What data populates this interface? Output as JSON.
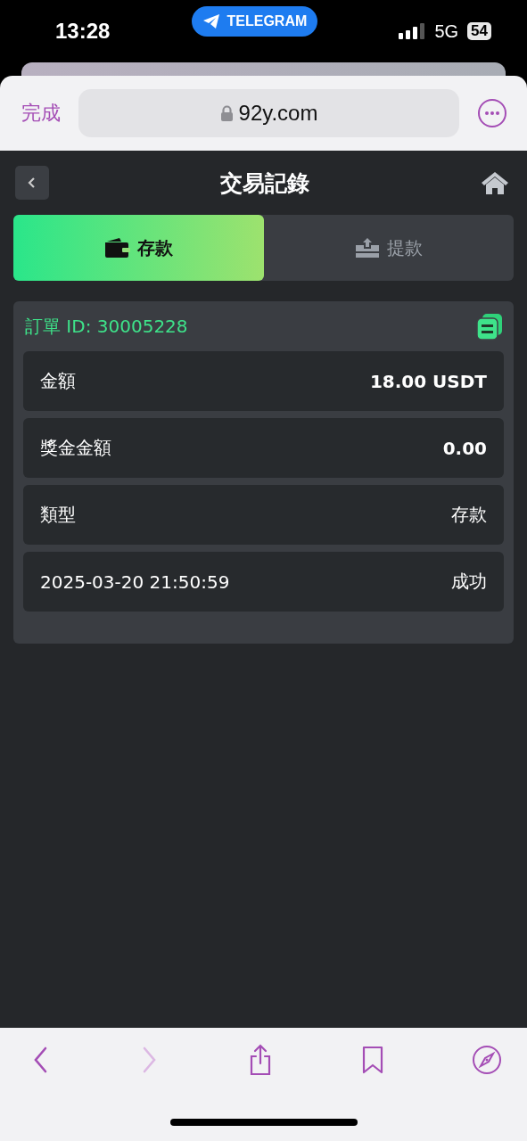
{
  "status_bar": {
    "time": "13:28",
    "back_app": "TELEGRAM",
    "network": "5G",
    "battery": "54"
  },
  "browser": {
    "done": "完成",
    "url": "92y.com"
  },
  "header": {
    "title": "交易記錄"
  },
  "tabs": [
    {
      "label": "存款",
      "kind": "deposit",
      "selected": true
    },
    {
      "label": "提款",
      "kind": "withdraw",
      "selected": false
    }
  ],
  "order": {
    "id_label": "訂單 ID: 30005228",
    "rows": [
      {
        "label": "金額",
        "value": "18.00 USDT",
        "kind": "bold"
      },
      {
        "label": "獎金金額",
        "value": "0.00",
        "kind": "bold"
      },
      {
        "label": "類型",
        "value": "存款",
        "kind": "plain"
      },
      {
        "label": "2025-03-20 21:50:59",
        "value": "成功",
        "kind": "plain"
      }
    ]
  },
  "toolbar": {
    "forward_disabled": true
  }
}
